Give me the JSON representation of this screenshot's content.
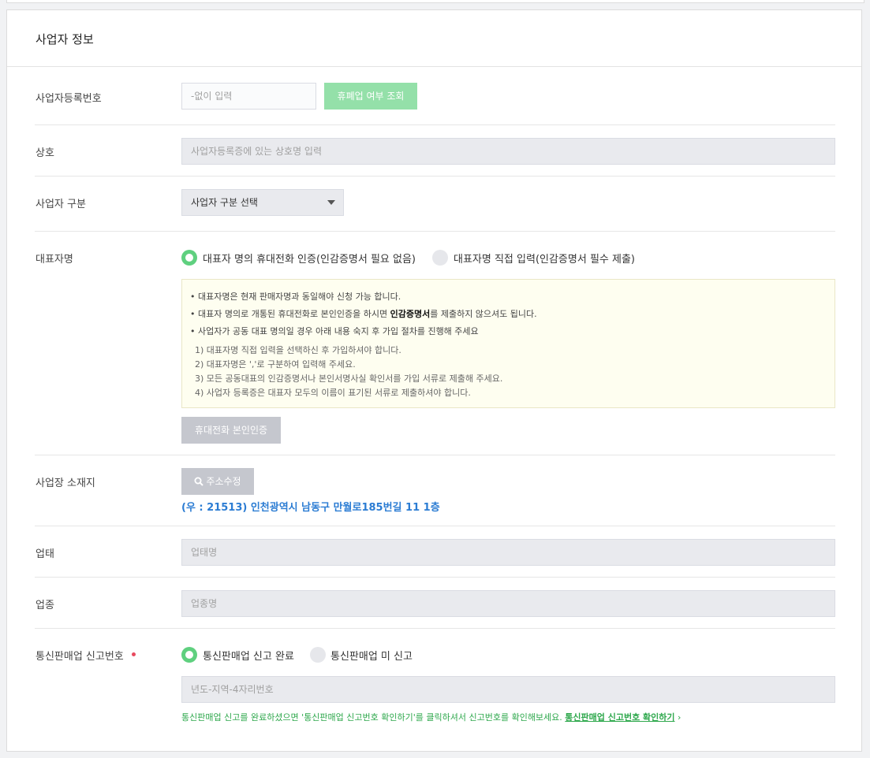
{
  "section_title": "사업자 정보",
  "fields": {
    "biz_reg_no": {
      "label": "사업자등록번호",
      "placeholder": "-없이 입력",
      "check_button": "휴폐업 여부 조회"
    },
    "company_name": {
      "label": "상호",
      "placeholder": "사업자등록증에 있는 상호명 입력"
    },
    "biz_type": {
      "label": "사업자 구분",
      "selected": "사업자 구분 선택"
    },
    "representative": {
      "label": "대표자명",
      "option_phone": "대표자 명의 휴대전화 인증(인감증명서 필요 없음)",
      "option_direct": "대표자명 직접 입력(인감증명서 필수 제출)",
      "notice": {
        "line1": "• 대표자명은 현재 판매자명과 동일해야 신청 가능 합니다.",
        "line2_pre": "• 대표자 명의로 개통된 휴대전화로 본인인증을 하시면 ",
        "line2_bold": "인감증명서",
        "line2_post": "를 제출하지 않으셔도 됩니다.",
        "line3": "• 사업자가 공동 대표 명의일 경우 아래 내용 숙지 후 가입 절차를 진행해 주세요",
        "sub1": "1) 대표자명 직접 입력을 선택하신 후 가입하셔야 합니다.",
        "sub2": "2) 대표자명은 ','로 구분하여 입력해 주세요.",
        "sub3": "3) 모든 공동대표의 인감증명서나 본인서명사실 확인서를 가입 서류로 제출해 주세요.",
        "sub4": "4) 사업자 등록증은 대표자 모두의 이름이 표기된 서류로 제출하셔야 합니다."
      },
      "verify_button": "휴대전화 본인인증"
    },
    "address": {
      "label": "사업장 소재지",
      "edit_button": "주소수정",
      "value": "(우 : 21513) 인천광역시 남동구 만월로185번길 11 1층"
    },
    "business_condition": {
      "label": "업태",
      "placeholder": "업태명"
    },
    "business_item": {
      "label": "업종",
      "placeholder": "업종명"
    },
    "ecommerce_report": {
      "label": "통신판매업 신고번호",
      "option_done": "통신판매업 신고 완료",
      "option_none": "통신판매업 미 신고",
      "placeholder": "년도-지역-4자리번호",
      "help_text": "통신판매업 신고를 완료하셨으면 '통신판매업 신고번호 확인하기'를 클릭하셔서 신고번호를 확인해보세요. ",
      "help_link": "통신판매업 신고번호 확인하기",
      "help_arrow": "›"
    }
  },
  "colors": {
    "accent_green": "#5fd07f",
    "link_blue": "#2b7cd3",
    "required_red": "#e84a5f",
    "notice_bg": "#fefef0"
  }
}
